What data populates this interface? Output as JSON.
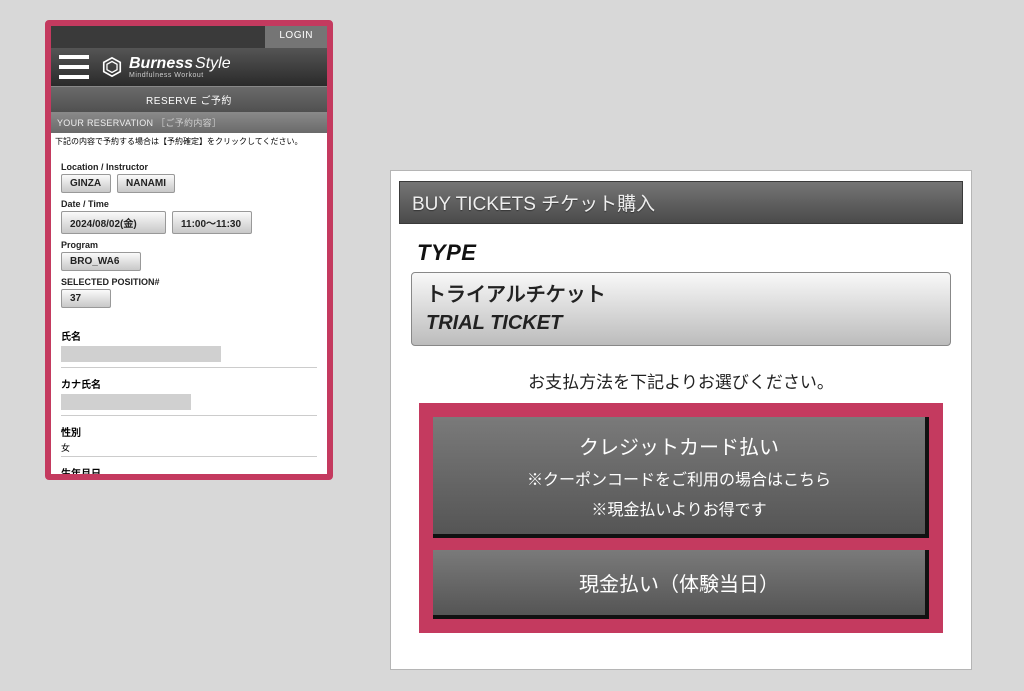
{
  "phone": {
    "login": "LOGIN",
    "brand_main": "Burness",
    "brand_sub": "Style",
    "brand_tag": "Mindfulness Workout",
    "reserve": "RESERVE ご予約",
    "res_title": "YOUR RESERVATION",
    "res_title_bracket": "［ご予約内容］",
    "instruction": "下記の内容で予約する場合は【予約確定】をクリックしてください。",
    "labels": {
      "loc": "Location / Instructor",
      "dt": "Date / Time",
      "prog": "Program",
      "pos": "SELECTED POSITION#",
      "name": "氏名",
      "kana": "カナ氏名",
      "gender": "性別",
      "gender_val": "女",
      "birth": "生年月日"
    },
    "values": {
      "location": "GINZA",
      "instructor": "NANAMI",
      "date": "2024/08/02(金)",
      "time": "11:00～11:30",
      "program": "BRO_WA6",
      "position": "37"
    }
  },
  "ticket": {
    "header": "BUY TICKETS チケット購入",
    "type_label": "TYPE",
    "type_jp": "トライアルチケット",
    "type_en": "TRIAL TICKET",
    "pay_instr": "お支払方法を下記よりお選びください。",
    "credit": {
      "main": "クレジットカード払い",
      "hint1": "※クーポンコードをご利用の場合はこちら",
      "hint2": "※現金払いよりお得です"
    },
    "cash": "現金払い（体験当日）"
  }
}
